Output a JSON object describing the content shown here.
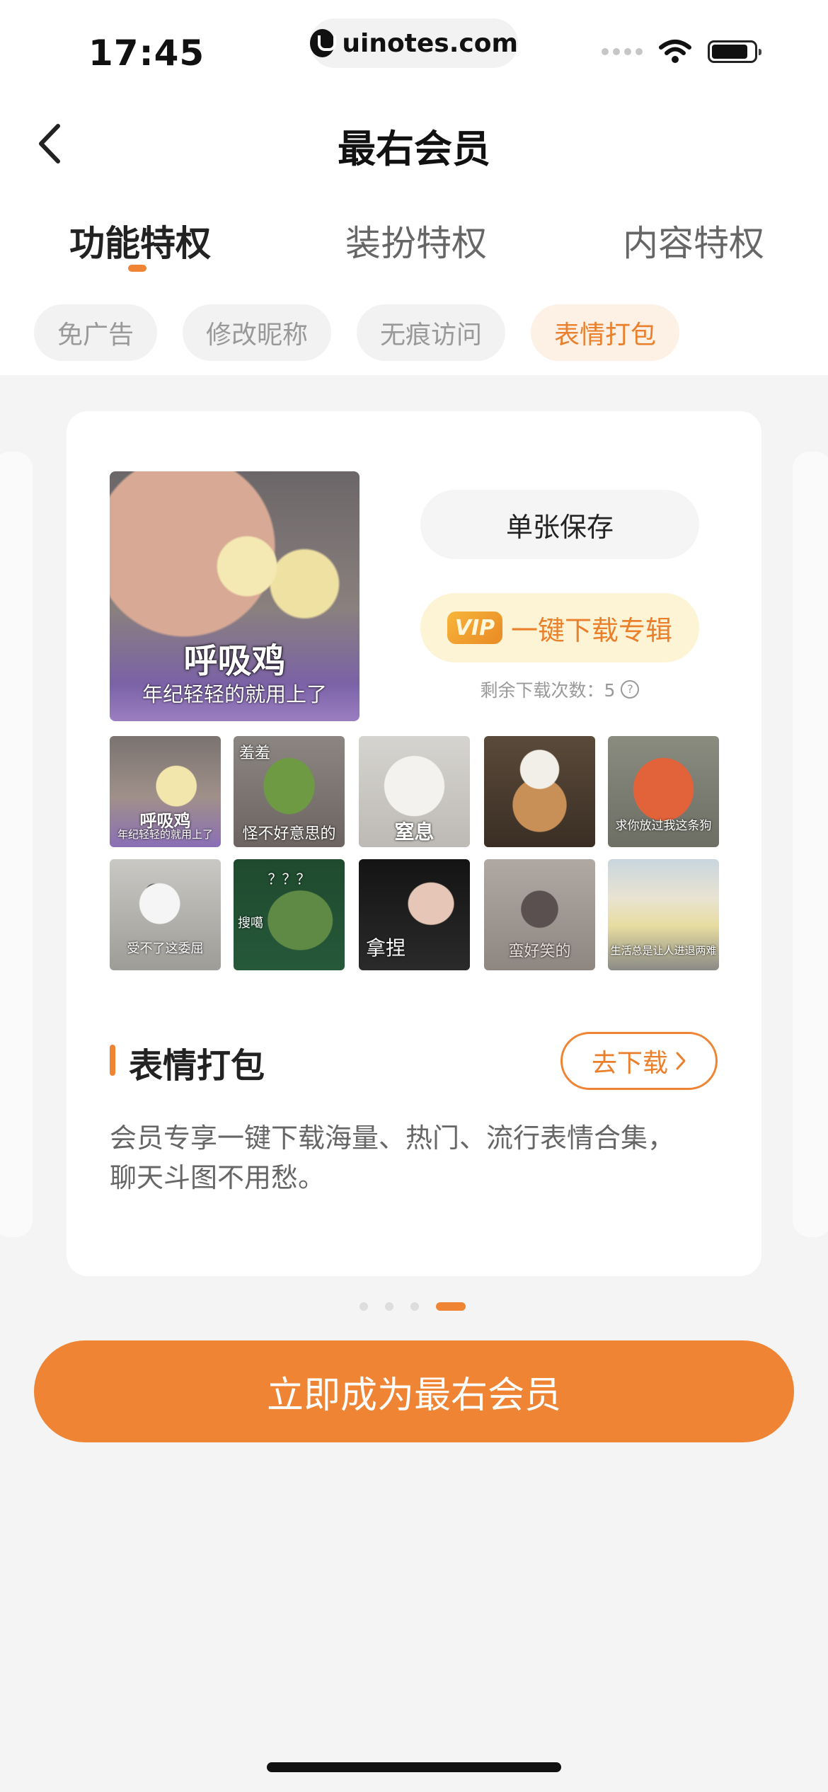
{
  "status_bar": {
    "time": "17:45",
    "url": "uinotes.com"
  },
  "header": {
    "title": "最右会员"
  },
  "tabs": [
    {
      "label": "功能特权",
      "active": true
    },
    {
      "label": "装扮特权",
      "active": false
    },
    {
      "label": "内容特权",
      "active": false
    }
  ],
  "chips": [
    {
      "label": "免广告",
      "active": false
    },
    {
      "label": "修改昵称",
      "active": false
    },
    {
      "label": "无痕访问",
      "active": false
    },
    {
      "label": "表情打包",
      "active": true
    }
  ],
  "card": {
    "main_image": {
      "caption1": "呼吸鸡",
      "caption2": "年纪轻轻的就用上了"
    },
    "save_button": "单张保存",
    "vip_badge": "VIP",
    "vip_button": "一键下载专辑",
    "remaining": "剩余下载次数：5",
    "help_icon": "?",
    "thumbnails": [
      {
        "caption": "呼吸鸡",
        "caption2": "年纪轻轻的就用上了"
      },
      {
        "caption": "羞羞",
        "caption2": "怪不好意思的"
      },
      {
        "caption": "窒息"
      },
      {
        "caption": ""
      },
      {
        "caption": "求你放过我这条狗"
      },
      {
        "caption": "受不了这委屈"
      },
      {
        "caption": "？？？",
        "caption2": "搜噶"
      },
      {
        "caption": "拿捏"
      },
      {
        "caption": "蛮好笑的"
      },
      {
        "caption": "生活总是让人进退两难"
      }
    ],
    "section_title": "表情打包",
    "download_button": "去下载",
    "description_line1": "会员专享一键下载海量、热门、流行表情合集，",
    "description_line2": "聊天斗图不用愁。"
  },
  "pagination": {
    "total": 4,
    "active": 4
  },
  "cta_button": "立即成为最右会员",
  "colors": {
    "accent": "#ef8434",
    "chip_active_bg": "#fdf0e5",
    "vip_bg": "#fdf4d6"
  }
}
